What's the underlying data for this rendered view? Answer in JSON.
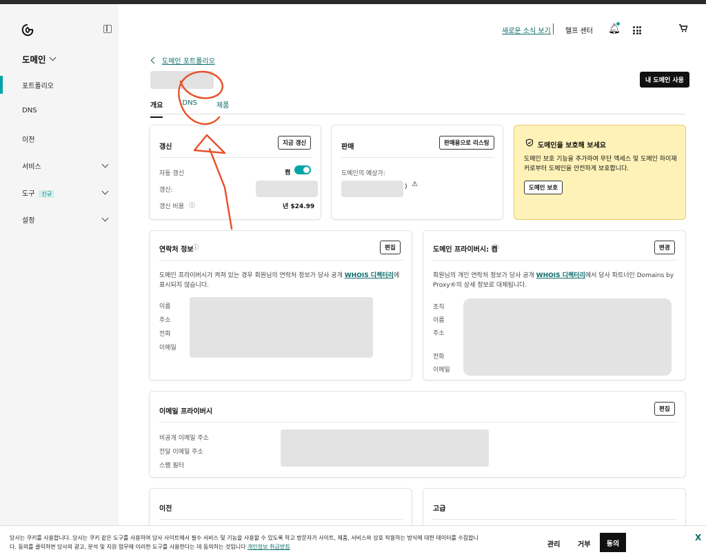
{
  "sidebar": {
    "title": "도메인",
    "items": [
      {
        "label": "포트폴리오",
        "active": true
      },
      {
        "label": "DNS"
      },
      {
        "label": "이전"
      },
      {
        "label": "서비스",
        "expandable": true
      },
      {
        "label": "도구",
        "badge": "신규",
        "expandable": true
      },
      {
        "label": "설정",
        "expandable": true
      }
    ]
  },
  "header": {
    "news_link": "새로운 소식 보기",
    "help": "헬프 센터"
  },
  "page": {
    "back_link": "도메인 포트폴리오",
    "use_my_domain": "내 도메인 사용",
    "tabs": [
      "개요",
      "DNS",
      "제품"
    ]
  },
  "renewal": {
    "title": "갱신",
    "button": "지금 갱신",
    "auto_renew_label": "자동 갱신",
    "auto_renew_value": "켬",
    "renew_label": "갱신:",
    "cost_label": "갱신 비용",
    "cost_value": "년 $24.99"
  },
  "sale": {
    "title": "판매",
    "button": "판매용으로 리스팅",
    "estimate_label": "도메인의 예상가:",
    "estimate_suffix": ")"
  },
  "promo": {
    "title": "도메인을 보호해 보세요",
    "text": "도메인 보호 기능을 추가하여 무단 액세스 및 도메인 하이재커로부터 도메인을 안전하게 보호합니다.",
    "button": "도메인 보호"
  },
  "contact": {
    "title": "연락처 정보",
    "button": "편집",
    "desc_before": "도메인 프라이버시가 켜져 있는 경우 회원님의 연락처 정보가 당사 공개 ",
    "desc_link": "WHOIS 디렉터리",
    "desc_after": "에 표시되지 않습니다.",
    "fields": [
      "이름",
      "주소",
      "전화",
      "이메일"
    ]
  },
  "privacy": {
    "title": "도메인 프라이버시: 켬",
    "button": "변경",
    "desc_before": "회원님의 개인 연락처 정보가 당사 공개 ",
    "desc_link": "WHOIS 디렉터리",
    "desc_after": "에서 당사 파트너인 Domains by Proxy®의 상세 정보로 대체됩니다.",
    "fields": [
      "조직",
      "이름",
      "주소",
      "전화",
      "이메일"
    ]
  },
  "email_privacy": {
    "title": "이메일 프라이버시",
    "button": "편집",
    "fields": [
      "비공개 이메일 주소",
      "전달 이메일 주소",
      "스팸 필터"
    ]
  },
  "transfer": {
    "title": "이전"
  },
  "advanced": {
    "title": "고급"
  },
  "cookie": {
    "line1": "당사는 쿠키를 사용합니다. 당사는 쿠키 같은 도구를 사용하여 당사 사이트에서 필수 서비스 및 기능을 사용할 수 있도록 하고 방문자가 사이트, 제품, 서비스와 상호 작용하는 방식에 대한 데이터를 수집합니",
    "line2": "다. 동의를 클릭하면 당사의 광고, 분석 및 지원 업무에 이러한 도구를 사용한다는 데 동의하는 것입니다",
    "policy_link": "개인정보 취급방침",
    "manage": "관리",
    "reject": "거부",
    "accept": "동의",
    "close": "X"
  },
  "colors": {
    "accent": "#00a4a6",
    "link": "#0a6b69",
    "annotation": "#e8522c",
    "promo_bg": "#fef2b8"
  }
}
